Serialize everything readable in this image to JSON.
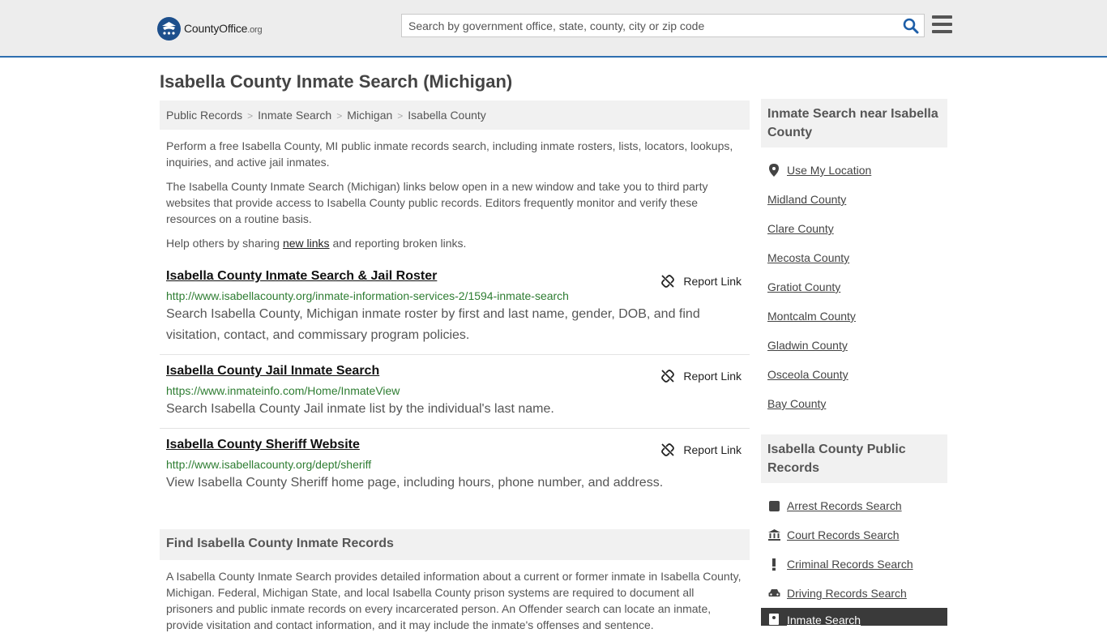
{
  "header": {
    "logo_main": "CountyOffice",
    "logo_suffix": ".org",
    "search_placeholder": "Search by government office, state, county, city or zip code"
  },
  "page_title": "Isabella County Inmate Search (Michigan)",
  "breadcrumb": [
    "Public Records",
    "Inmate Search",
    "Michigan",
    "Isabella County"
  ],
  "intro": {
    "p1": "Perform a free Isabella County, MI public inmate records search, including inmate rosters, lists, locators, lookups, inquiries, and active jail inmates.",
    "p2": "The Isabella County Inmate Search (Michigan) links below open in a new window and take you to third party websites that provide access to Isabella County public records. Editors frequently monitor and verify these resources on a routine basis.",
    "p3_before": "Help others by sharing ",
    "p3_link": "new links",
    "p3_after": " and reporting broken links."
  },
  "report_label": "Report Link",
  "links": [
    {
      "title": "Isabella County Inmate Search & Jail Roster",
      "url": "http://www.isabellacounty.org/inmate-information-services-2/1594-inmate-search",
      "desc": "Search Isabella County, Michigan inmate roster by first and last name, gender, DOB, and find visitation, contact, and commissary program policies."
    },
    {
      "title": "Isabella County Jail Inmate Search",
      "url": "https://www.inmateinfo.com/Home/InmateView",
      "desc": "Search Isabella County Jail inmate list by the individual's last name."
    },
    {
      "title": "Isabella County Sheriff Website",
      "url": "http://www.isabellacounty.org/dept/sheriff",
      "desc": "View Isabella County Sheriff home page, including hours, phone number, and address."
    }
  ],
  "find_section": {
    "heading": "Find Isabella County Inmate Records",
    "text": "A Isabella County Inmate Search provides detailed information about a current or former inmate in Isabella County, Michigan. Federal, Michigan State, and local Isabella County prison systems are required to document all prisoners and public inmate records on every incarcerated person. An Offender search can locate an inmate, provide visitation and contact information, and it may include the inmate's offenses and sentence."
  },
  "sidebar": {
    "nearby_heading": "Inmate Search near Isabella County",
    "use_location": "Use My Location",
    "nearby": [
      "Midland County",
      "Clare County",
      "Mecosta County",
      "Gratiot County",
      "Montcalm County",
      "Gladwin County",
      "Osceola County",
      "Bay County"
    ],
    "records_heading": "Isabella County Public Records",
    "records": [
      {
        "label": "Arrest Records Search",
        "icon": "square-icon"
      },
      {
        "label": "Court Records Search",
        "icon": "courthouse-icon"
      },
      {
        "label": "Criminal Records Search",
        "icon": "exclamation-icon"
      },
      {
        "label": "Driving Records Search",
        "icon": "car-icon"
      }
    ],
    "active_item": "Inmate Search"
  },
  "colors": {
    "header_bg": "#ededed",
    "accent_blue": "#2f6fb0",
    "url_green": "#2e7d32",
    "panel_bg": "#f1f1f1"
  }
}
